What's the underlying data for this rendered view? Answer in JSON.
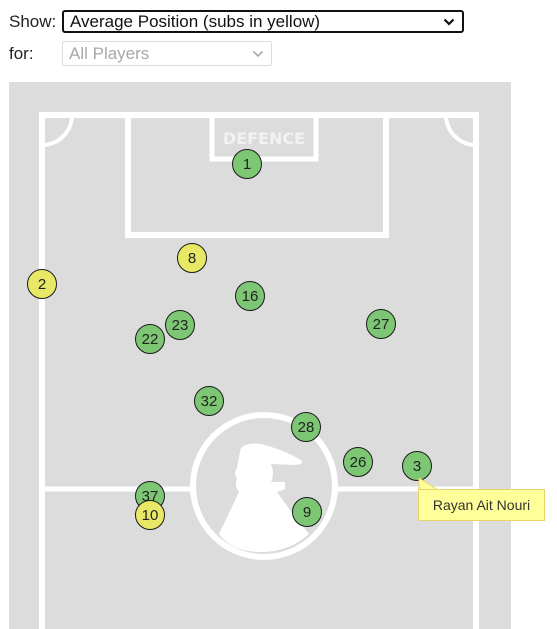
{
  "controls": {
    "show_label": "Show:",
    "show_value": "Average Position (subs in yellow)",
    "for_label": "for:",
    "for_value": "All Players",
    "for_disabled": true
  },
  "pitch": {
    "zone_label": "DEFENCE",
    "colors": {
      "field": "#dcdcdc",
      "lines": "#ffffff",
      "starter": "#7dc674",
      "sub": "#e8e866"
    }
  },
  "players": [
    {
      "number": "1",
      "role": "starter"
    },
    {
      "number": "8",
      "role": "sub"
    },
    {
      "number": "2",
      "role": "sub"
    },
    {
      "number": "16",
      "role": "starter"
    },
    {
      "number": "23",
      "role": "starter"
    },
    {
      "number": "22",
      "role": "starter"
    },
    {
      "number": "27",
      "role": "starter"
    },
    {
      "number": "32",
      "role": "starter"
    },
    {
      "number": "28",
      "role": "starter"
    },
    {
      "number": "26",
      "role": "starter"
    },
    {
      "number": "3",
      "role": "starter"
    },
    {
      "number": "37",
      "role": "starter"
    },
    {
      "number": "10",
      "role": "sub"
    },
    {
      "number": "9",
      "role": "starter"
    }
  ],
  "tooltip": {
    "text": "Rayan Ait Nouri",
    "player_number": "3"
  }
}
